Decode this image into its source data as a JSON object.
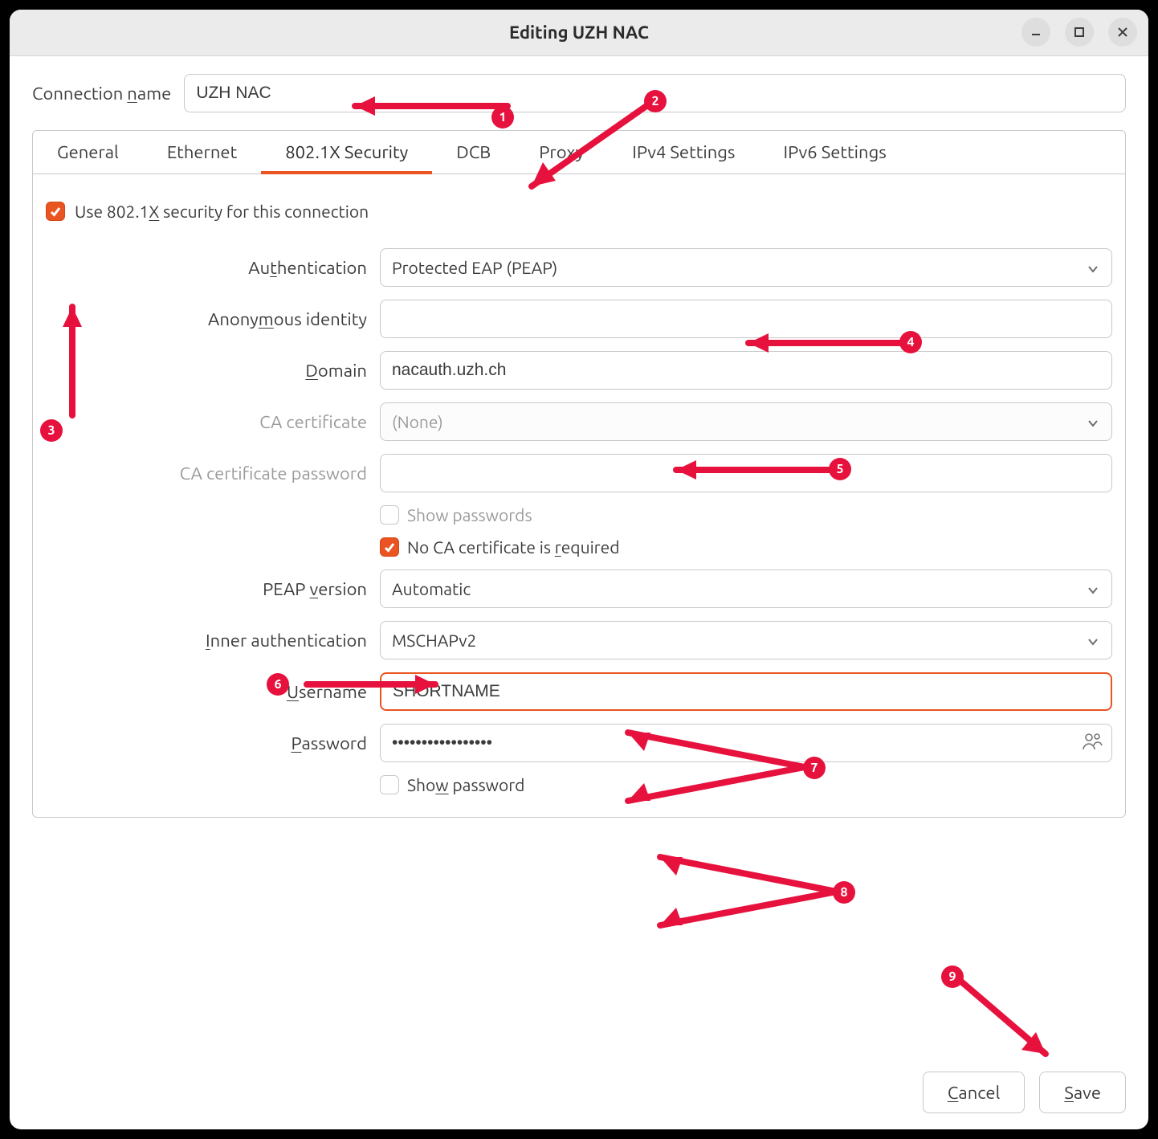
{
  "window": {
    "title": "Editing UZH NAC"
  },
  "connection_name": {
    "label_pre": "Connection ",
    "label_ul": "n",
    "label_post": "ame",
    "value": "UZH NAC"
  },
  "tabs": {
    "items": [
      {
        "label": "General"
      },
      {
        "label": "Ethernet"
      },
      {
        "label": "802.1X Security"
      },
      {
        "label": "DCB"
      },
      {
        "label": "Proxy"
      },
      {
        "label": "IPv4 Settings"
      },
      {
        "label": "IPv6 Settings"
      }
    ],
    "active_index": 2
  },
  "security": {
    "use_8021x": {
      "pre": "Use 802.1",
      "ul": "X",
      "post": " security for this connection",
      "checked": true
    },
    "fields": {
      "authentication": {
        "label_pre": "Au",
        "label_ul": "t",
        "label_post": "hentication",
        "value": "Protected EAP (PEAP)"
      },
      "anon_identity": {
        "label_pre": "Anony",
        "label_ul": "m",
        "label_post": "ous identity",
        "value": ""
      },
      "domain": {
        "label_ul": "D",
        "label_post": "omain",
        "value": "nacauth.uzh.ch"
      },
      "ca_cert": {
        "label": "CA certificate",
        "value": "(None)"
      },
      "ca_cert_pw": {
        "label": "CA certificate password",
        "value": ""
      },
      "show_passwords": {
        "label": "Show passwords",
        "checked": false
      },
      "no_ca_required": {
        "pre": "No CA certificate is ",
        "ul": "r",
        "post": "equired",
        "checked": true
      },
      "peap_version": {
        "label_pre": "PEAP ",
        "label_ul": "v",
        "label_post": "ersion",
        "value": "Automatic"
      },
      "inner_auth": {
        "label_ul": "I",
        "label_post": "nner authentication",
        "value": "MSCHAPv2"
      },
      "username": {
        "label_ul": "U",
        "label_post": "sername",
        "value": "SHORTNAME"
      },
      "password": {
        "label_ul": "P",
        "label_post": "assword",
        "value": "•••••••••••••••••"
      },
      "show_password": {
        "pre": "Sho",
        "ul": "w",
        "post": " password",
        "checked": false
      }
    }
  },
  "buttons": {
    "cancel_ul": "C",
    "cancel_post": "ancel",
    "save_ul": "S",
    "save_post": "ave"
  },
  "annotations": {
    "1": "1",
    "2": "2",
    "3": "3",
    "4": "4",
    "5": "5",
    "6": "6",
    "7": "7",
    "8": "8",
    "9": "9"
  }
}
